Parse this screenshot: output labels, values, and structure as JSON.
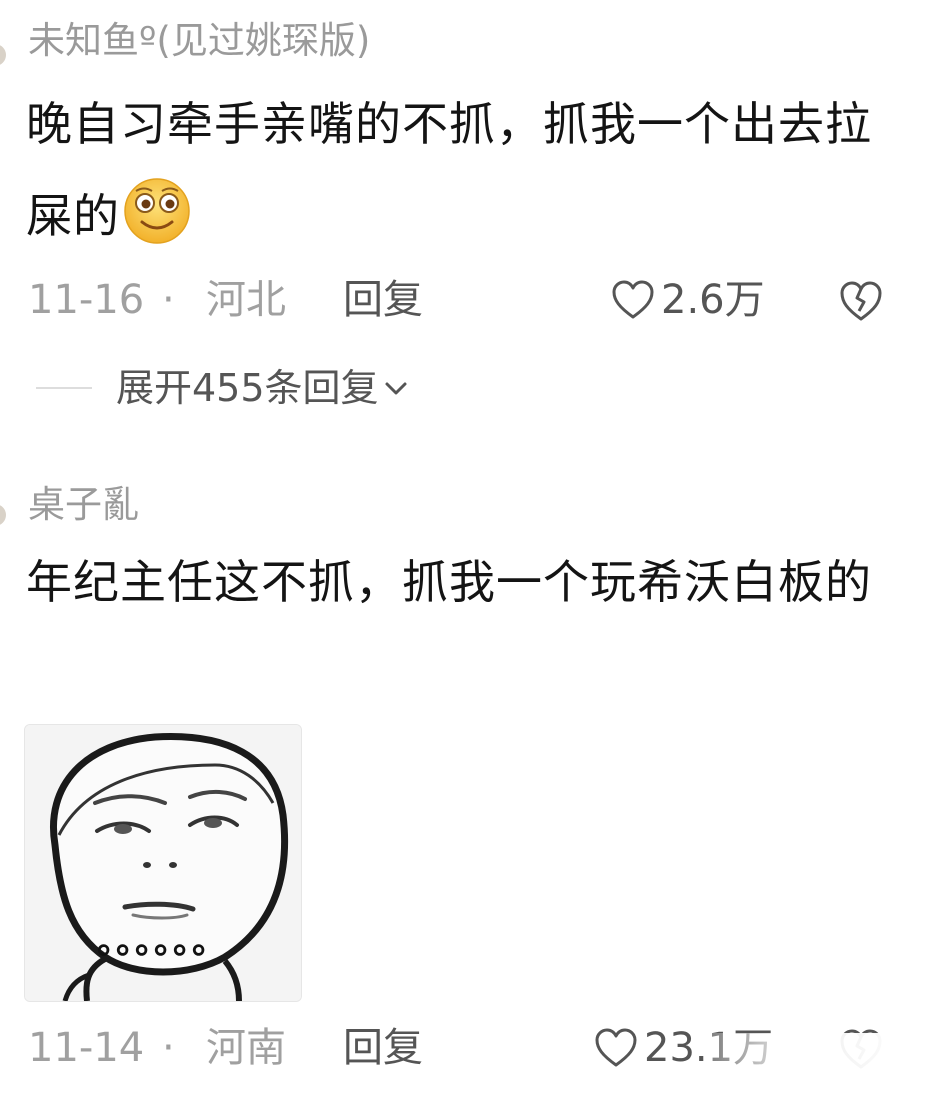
{
  "comments": [
    {
      "username": "未知鱼º(见过姚琛版)",
      "text": "晚自习牵手亲嘴的不抓，抓我一个出去拉屎的",
      "emoji": "grinning-face-emoji",
      "date": "11-16",
      "separator": "·",
      "location": "河北",
      "reply_label": "回复",
      "likes": "2.6万",
      "expand_replies": "展开455条回复"
    },
    {
      "username": "桌子亂",
      "text": "年纪主任这不抓，抓我一个玩希沃白板的",
      "image": "sketch-face-meme",
      "image_caption": "。。。。。。",
      "date": "11-14",
      "separator": "·",
      "location": "河南",
      "reply_label": "回复",
      "likes": "23.1万"
    }
  ],
  "icons": {
    "like": "heart-outline-icon",
    "dislike": "broken-heart-icon",
    "expand": "chevron-down-icon"
  },
  "colors": {
    "username": "#9a9a9a",
    "body_text": "#141414",
    "meta_text": "#a0a0a0",
    "action_text": "#555555",
    "emoji_yellow": "#f8c53a"
  }
}
